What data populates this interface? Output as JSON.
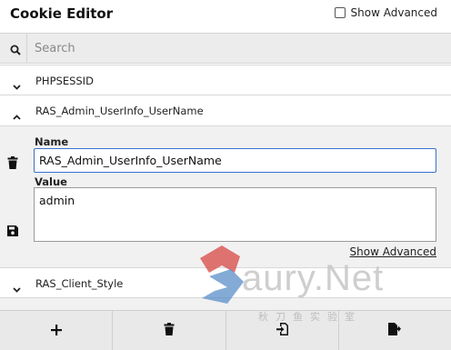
{
  "header": {
    "title": "Cookie Editor",
    "show_advanced_label": "Show Advanced"
  },
  "search": {
    "placeholder": "Search",
    "value": ""
  },
  "cookies": [
    {
      "name": "PHPSESSID",
      "expanded": false
    },
    {
      "name": "RAS_Admin_UserInfo_UserName",
      "expanded": true
    },
    {
      "name": "RAS_Client_Style",
      "expanded": false
    }
  ],
  "editor": {
    "name_label": "Name",
    "name_value": "RAS_Admin_UserInfo_UserName",
    "value_label": "Value",
    "value_value": "admin",
    "show_advanced_link": "Show Advanced"
  },
  "toolbar": {
    "buttons": [
      "add-icon",
      "delete-icon",
      "import-icon",
      "export-icon"
    ]
  },
  "watermark": {
    "text": "aury.Net",
    "subtext": "秋刀鱼实验室"
  },
  "colors": {
    "accent_border": "#3b6fd1",
    "panel_bg": "#f1f1f1",
    "toolbar_bg": "#e9e9e9",
    "watermark_red": "#d9534f",
    "watermark_blue": "#5a8fc8"
  }
}
